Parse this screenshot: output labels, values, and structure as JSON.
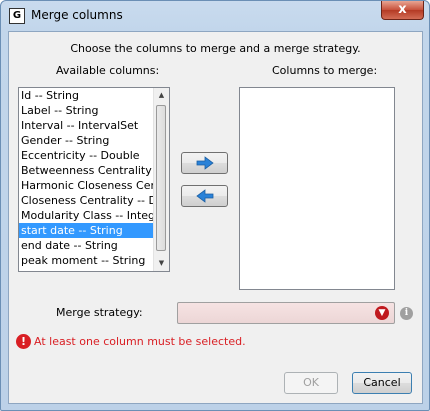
{
  "window": {
    "title": "Merge columns",
    "close_label": "x",
    "app_icon_glyph": "G"
  },
  "instruction": "Choose the columns to merge and a merge strategy.",
  "available": {
    "header": "Available columns:",
    "items": [
      "Id -- String",
      "Label -- String",
      "Interval -- IntervalSet",
      "Gender -- String",
      "Eccentricity -- Double",
      "Betweenness Centrality -- D",
      "Harmonic Closeness Central",
      "Closeness Centrality -- Doul",
      "Modularity Class -- Integer",
      "start date -- String",
      "end date -- String",
      "peak moment -- String"
    ],
    "selected_index": 9
  },
  "merge": {
    "header": "Columns to merge:"
  },
  "strategy": {
    "label": "Merge strategy:",
    "value": ""
  },
  "error": {
    "icon_glyph": "!",
    "message": "At least one column must be selected."
  },
  "buttons": {
    "ok": "OK",
    "cancel": "Cancel"
  },
  "colors": {
    "selection": "#3399ff",
    "error": "#d91f24",
    "arrow": "#2a82d8"
  }
}
